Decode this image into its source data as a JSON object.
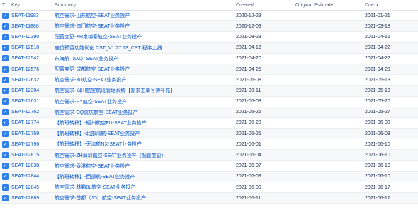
{
  "columns": {
    "type": "T",
    "key": "Key",
    "summary": "Summary",
    "created": "Created",
    "original_estimate": "Original Estimate",
    "due": "Due"
  },
  "sort": {
    "column": "due",
    "direction": "ascending",
    "icon": "arrow-up-icon"
  },
  "type_icon": {
    "name": "story-icon",
    "color": "#2f80ed"
  },
  "rows": [
    {
      "key": "SEAT-11983",
      "summary": "航空需求-山东航空-SEAT业务投产",
      "created": "2020-12-23",
      "original_estimate": "",
      "due": "2021-01-21"
    },
    {
      "key": "SEAT-11880",
      "summary": "航空需求-澳门航空-SEAT业务投产",
      "created": "2020-12-03",
      "original_estimate": "",
      "due": "2021-03-18"
    },
    {
      "key": "SEAT-12390",
      "summary": "配置变更-XR柬埔寨航空-SEAT业务投产",
      "created": "2021-03-23",
      "original_estimate": "",
      "due": "2021-04-15"
    },
    {
      "key": "SEAT-12510",
      "summary": "座位预留功能优化 CST_V1.27.13_CST 程序上线",
      "created": "2021-04-16",
      "original_estimate": "",
      "due": "2021-04-22"
    },
    {
      "key": "SEAT-12542",
      "summary": "东海航（DZ）SEAT业务投产",
      "created": "2021-04-20",
      "original_estimate": "",
      "due": "2021-04-22"
    },
    {
      "key": "SEAT-12576",
      "summary": "配置变更-成都航空-SEAT业务投产",
      "created": "2021-04-25",
      "original_estimate": "",
      "due": "2021-04-29"
    },
    {
      "key": "SEAT-12632",
      "summary": "航空需求-3U航空-SEAT业务投产",
      "created": "2021-05-08",
      "original_estimate": "",
      "due": "2021-05-13"
    },
    {
      "key": "SEAT-12304",
      "summary": "航空需求-四川航空航班管理系统【需求工单号待补充】",
      "created": "2021-03-11",
      "original_estimate": "",
      "due": "2021-05-13"
    },
    {
      "key": "SEAT-12631",
      "summary": "航空需求-RY航空-SEAT业务投产",
      "created": "2021-05-08",
      "original_estimate": "",
      "due": "2021-05-20"
    },
    {
      "key": "SEAT-12762",
      "summary": "航空需求-OQ重庆航空-SEAT业务投产",
      "created": "2021-05-25",
      "original_estimate": "",
      "due": "2021-05-27"
    },
    {
      "key": "SEAT-12774",
      "summary": "【航班转移】-福州航空FU-SEAT业务投产",
      "created": "2021-05-28",
      "original_estimate": "",
      "due": "2021-06-03"
    },
    {
      "key": "SEAT-12759",
      "summary": "【航班转移】-北部湾航-SEAT业务投产",
      "created": "2021-05-25",
      "original_estimate": "",
      "due": "2021-06-03"
    },
    {
      "key": "SEAT-12796",
      "summary": "【航班转移】-天津航NX-SEAT业务投产",
      "created": "2021-06-01",
      "original_estimate": "",
      "due": "2021-06-10"
    },
    {
      "key": "SEAT-12815",
      "summary": "航空需求-ZH深圳航空-SEAT业务投产（配置变更）",
      "created": "2021-06-04",
      "original_estimate": "",
      "due": "2021-06-10"
    },
    {
      "key": "SEAT-12838",
      "summary": "航空需求-香港航空-SEAT业务投产",
      "created": "2021-06-07",
      "original_estimate": "",
      "due": "2021-06-10"
    },
    {
      "key": "SEAT-12844",
      "summary": "【航班转移】-西部航-SEAT业务投产",
      "created": "2021-06-09",
      "original_estimate": "",
      "due": "2021-06-10"
    },
    {
      "key": "SEAT-12845",
      "summary": "航空需求-林鹏8L航空-SEAT业务投产",
      "created": "2021-06-09",
      "original_estimate": "",
      "due": "2021-06-17"
    },
    {
      "key": "SEAT-12869",
      "summary": "航空需求-首都（JD）航空-SEAT业务投产",
      "created": "2021-06-11",
      "original_estimate": "",
      "due": "2021-06-17"
    }
  ]
}
